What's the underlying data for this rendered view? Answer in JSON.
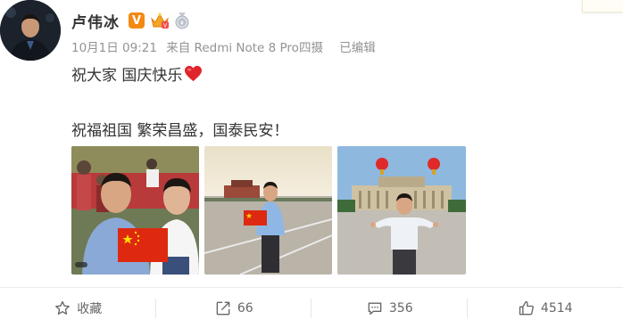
{
  "post": {
    "author": "卢伟冰",
    "timestamp": "10月1日 09:21",
    "source": "来自 Redmi Note 8 Pro四摄",
    "edited": "已编辑",
    "line1": "祝大家 国庆快乐",
    "line2": "祝福祖国  繁荣昌盛，国泰民安！",
    "badge_v": "V"
  },
  "actions": {
    "favorite_label": "收藏",
    "repost_count": "66",
    "comment_count": "356",
    "like_count": "4514"
  },
  "icons": {
    "verified": "v-badge-icon",
    "crown": "crown-badge-icon",
    "medal": "medal-badge-icon",
    "heart": "heart-icon",
    "favorite": "star-icon",
    "repost": "share-arrow-icon",
    "comment": "comment-icon",
    "like": "thumbs-up-icon"
  },
  "colors": {
    "accent_orange": "#f28a13",
    "heart_red": "#e0242b",
    "meta_gray": "#939393",
    "flag_red": "#de2910"
  }
}
